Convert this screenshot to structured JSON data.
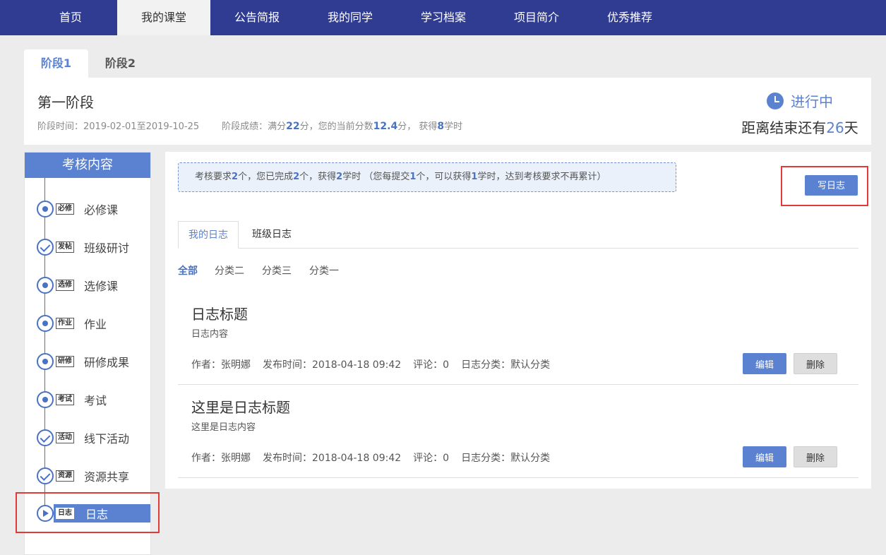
{
  "nav": {
    "items": [
      "首页",
      "我的课堂",
      "公告简报",
      "我的同学",
      "学习档案",
      "项目简介",
      "优秀推荐"
    ],
    "active_index": 1
  },
  "stage_tabs": [
    "阶段1",
    "阶段2"
  ],
  "stage": {
    "title": "第一阶段",
    "time_prefix": "阶段时间：",
    "time_range": "2019-02-01至2019-10-25",
    "score_prefix": "阶段成绩：满分",
    "full_score": "22",
    "score_mid": "分，您的当前分数",
    "current_score": "12.4",
    "score_mid2": "分，  获得",
    "hours": "8",
    "score_suffix": "学时",
    "status": "进行中",
    "countdown_prefix": "距离结束还有",
    "countdown_days": "26",
    "countdown_suffix": "天"
  },
  "sidebar": {
    "title": "考核内容",
    "items": [
      {
        "badge": "必修",
        "label": "必修课",
        "icon": "dot-icon"
      },
      {
        "badge": "发帖",
        "label": "班级研讨",
        "icon": "check-icon"
      },
      {
        "badge": "选修",
        "label": "选修课",
        "icon": "dot-icon"
      },
      {
        "badge": "作业",
        "label": "作业",
        "icon": "dot-icon"
      },
      {
        "badge": "研修",
        "label": "研修成果",
        "icon": "dot-icon"
      },
      {
        "badge": "考试",
        "label": "考试",
        "icon": "dot-icon"
      },
      {
        "badge": "活动",
        "label": "线下活动",
        "icon": "check-icon"
      },
      {
        "badge": "资源",
        "label": "资源共享",
        "icon": "check-icon"
      },
      {
        "badge": "日志",
        "label": "日志",
        "icon": "play-icon"
      }
    ],
    "active_index": 8
  },
  "notice": {
    "p1": "考核要求",
    "required": "2",
    "p2": "个，您已完成",
    "completed": "2",
    "p3": "个，获得",
    "earned": "2",
    "p4": "学时 （您每提交",
    "per": "1",
    "p5": "个，可以获得",
    "per_hours": "1",
    "p6": "学时，达到考核要求不再累计）"
  },
  "write_button": "写日志",
  "log_tabs": [
    "我的日志",
    "班级日志"
  ],
  "filters": [
    "全部",
    "分类二",
    "分类三",
    "分类一"
  ],
  "entries": [
    {
      "title": "日志标题",
      "content": "日志内容",
      "author": "作者：张明娜",
      "time": "发布时间：2018-04-18 09:42",
      "comments": "评论：0",
      "category": "日志分类：默认分类"
    },
    {
      "title": "这里是日志标题",
      "content": "这里是日志内容",
      "author": "作者：张明娜",
      "time": "发布时间：2018-04-18 09:42",
      "comments": "评论：0",
      "category": "日志分类：默认分类"
    }
  ],
  "entry_actions": {
    "edit": "编辑",
    "delete": "删除"
  },
  "colors": {
    "nav_bg": "#303c92",
    "accent": "#5b82d0",
    "highlight_box": "#e03a3a"
  }
}
